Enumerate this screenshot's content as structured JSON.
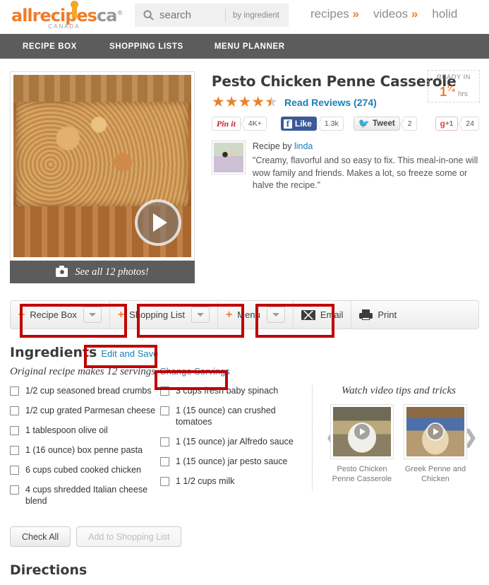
{
  "header": {
    "logo": {
      "main": "allrecipes",
      "dot": "i",
      "suffix": "ca",
      "reg": "®",
      "country": "CANADA"
    },
    "search": {
      "placeholder": "search",
      "value": "",
      "by_ingredient": "by ingredient",
      "icon": "search-icon"
    },
    "topnav": [
      {
        "label": "recipes",
        "chev": "»"
      },
      {
        "label": "videos",
        "chev": "»"
      },
      {
        "label": "holid",
        "chev": ""
      }
    ]
  },
  "subnav": {
    "items": [
      {
        "label": "RECIPE BOX"
      },
      {
        "label": "SHOPPING LISTS"
      },
      {
        "label": "MENU PLANNER"
      }
    ]
  },
  "photo": {
    "play_icon": "play-icon",
    "banner_icon": "camera-icon",
    "banner_label": "See all 12 photos!"
  },
  "recipe": {
    "title": "Pesto Chicken Penne Casserole",
    "ready_in": {
      "label": "READY IN",
      "whole": "1",
      "fraction": "¼",
      "unit": "hrs"
    },
    "rating": {
      "stars": 4.5,
      "read_reviews": "Read Reviews",
      "count": "(274)"
    },
    "social": {
      "pin": {
        "label": "Pin it",
        "count": "4K+"
      },
      "facebook": {
        "icon": "f",
        "label": "Like",
        "count": "1.3k"
      },
      "twitter": {
        "icon": "twitter-bird-icon",
        "label": "Tweet",
        "count": "2"
      },
      "google": {
        "label": "g",
        "plus": "+1",
        "count": "24"
      }
    },
    "author": {
      "by_label": "Recipe by ",
      "name": "linda",
      "quote": "\"Creamy, flavorful and so easy to fix. This meal-in-one will wow family and friends. Makes a lot, so freeze some or halve the recipe.\""
    }
  },
  "actionbar": {
    "recipe_box": "Recipe Box",
    "shopping_list": "Shopping List",
    "menu": "Menu",
    "email": "Email",
    "print": "Print",
    "plus": "+"
  },
  "ingredients": {
    "heading": "Ingredients",
    "edit_and_save": "Edit and Save",
    "servings_text": "Original recipe makes 12 servings",
    "change_servings": "Change Servings",
    "col1": [
      "1/2 cup seasoned bread crumbs",
      "1/2 cup grated Parmesan cheese",
      "1 tablespoon olive oil",
      "1 (16 ounce) box penne pasta",
      "6 cups cubed cooked chicken",
      "4 cups shredded Italian cheese blend"
    ],
    "col2": [
      "3 cups fresh baby spinach",
      "1 (15 ounce) can crushed tomatoes",
      "1 (15 ounce) jar Alfredo sauce",
      "1 (15 ounce) jar pesto sauce",
      "1 1/2 cups milk"
    ],
    "check_all": "Check All",
    "add_to_shopping_list": "Add to Shopping List"
  },
  "videos": {
    "title": "Watch video tips and tricks",
    "prev_icon": "chevron-left-icon",
    "next_icon": "chevron-right-icon",
    "items": [
      {
        "caption": "Pesto Chicken Penne Casserole"
      },
      {
        "caption": "Greek Penne and Chicken"
      }
    ]
  },
  "directions": {
    "heading": "Directions"
  },
  "colors": {
    "brand_orange": "#f07c28",
    "link_blue": "#1a80b6",
    "subnav_gray": "#5c5c5c",
    "annotation_red": "#c00000",
    "star_orange": "#e8822b"
  }
}
